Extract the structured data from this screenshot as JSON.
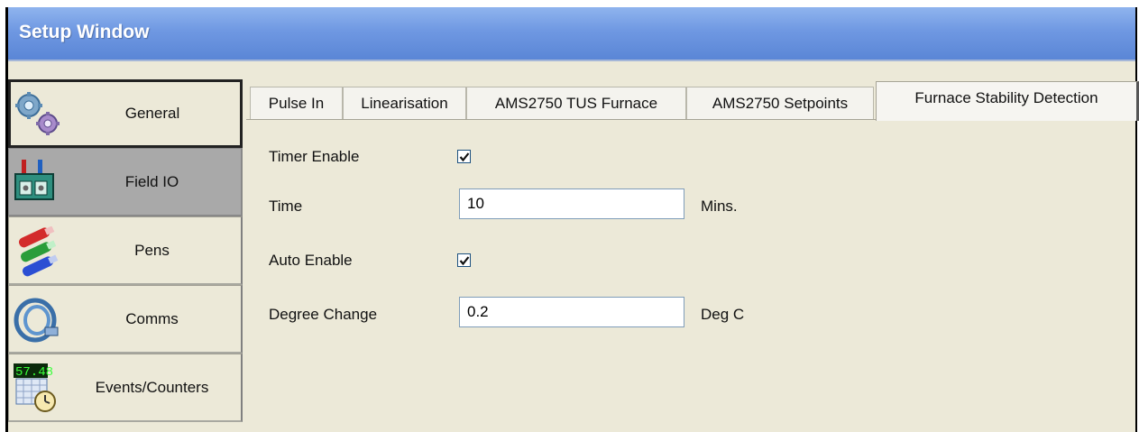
{
  "window": {
    "title": "Setup Window"
  },
  "nav": {
    "items": [
      {
        "label": "General",
        "icon": "gears-icon"
      },
      {
        "label": "Field IO",
        "icon": "field-io-icon"
      },
      {
        "label": "Pens",
        "icon": "pens-icon"
      },
      {
        "label": "Comms",
        "icon": "cable-icon"
      },
      {
        "label": "Events/Counters",
        "icon": "calendar-clock-icon",
        "icon_text": "57.48"
      }
    ]
  },
  "tabs": [
    {
      "label": "Pulse In"
    },
    {
      "label": "Linearisation"
    },
    {
      "label": "AMS2750 TUS Furnace"
    },
    {
      "label": "AMS2750 Setpoints"
    },
    {
      "label": "Furnace Stability Detection"
    }
  ],
  "form": {
    "timer_enable": {
      "label": "Timer Enable",
      "checked": true
    },
    "time": {
      "label": "Time",
      "value": "10",
      "unit": "Mins."
    },
    "auto_enable": {
      "label": "Auto Enable",
      "checked": true
    },
    "degree_change": {
      "label": "Degree Change",
      "value": "0.2",
      "unit": "Deg C"
    }
  },
  "colors": {
    "titlebar": "#6f98e2",
    "window_bg": "#ece9d8",
    "active_nav": "#a9a9a9"
  }
}
